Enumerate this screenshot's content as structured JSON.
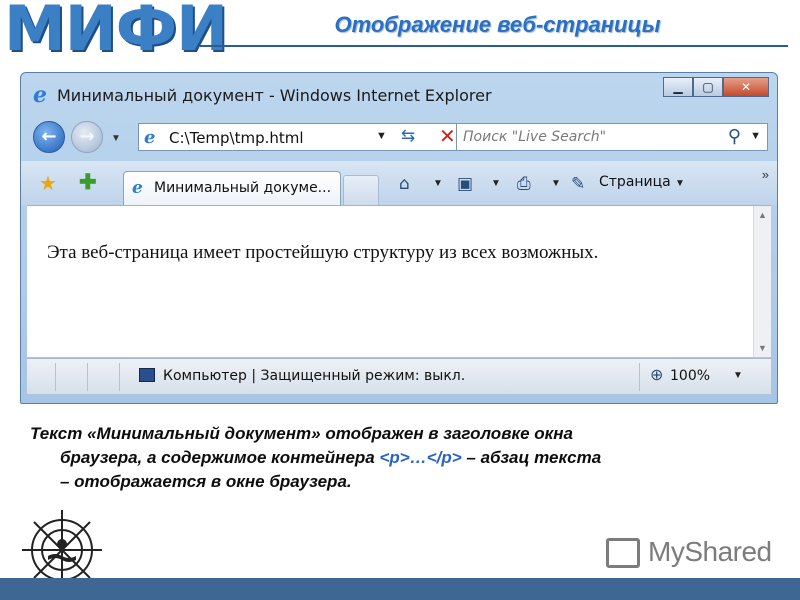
{
  "slide": {
    "logo": "МИФИ",
    "title": "Отображение веб-страницы"
  },
  "browser": {
    "window_title": "Минимальный документ - Windows Internet Explorer",
    "address": "C:\\Temp\\tmp.html",
    "search_placeholder": "Поиск \"Live Search\"",
    "tab_label": "Минимальный докуме...",
    "page_menu_label": "Страница",
    "content_text": "Эта веб-страница имеет простейшую структуру из всех возможных.",
    "status_text": "Компьютер | Защищенный режим: выкл.",
    "zoom": "100%"
  },
  "caption": {
    "line1": "Текст «Минимальный документ» отображен в заголовке окна",
    "line2_before": "браузера, а содержимое контейнера ",
    "line2_code": "<p>…</p>",
    "line2_after": " – абзац текста",
    "line3": "– отображается в окне браузера."
  },
  "watermark": "MyShared",
  "colors": {
    "accent": "#2a6fc1",
    "footer": "#3f6794",
    "code": "#2a63c0"
  }
}
